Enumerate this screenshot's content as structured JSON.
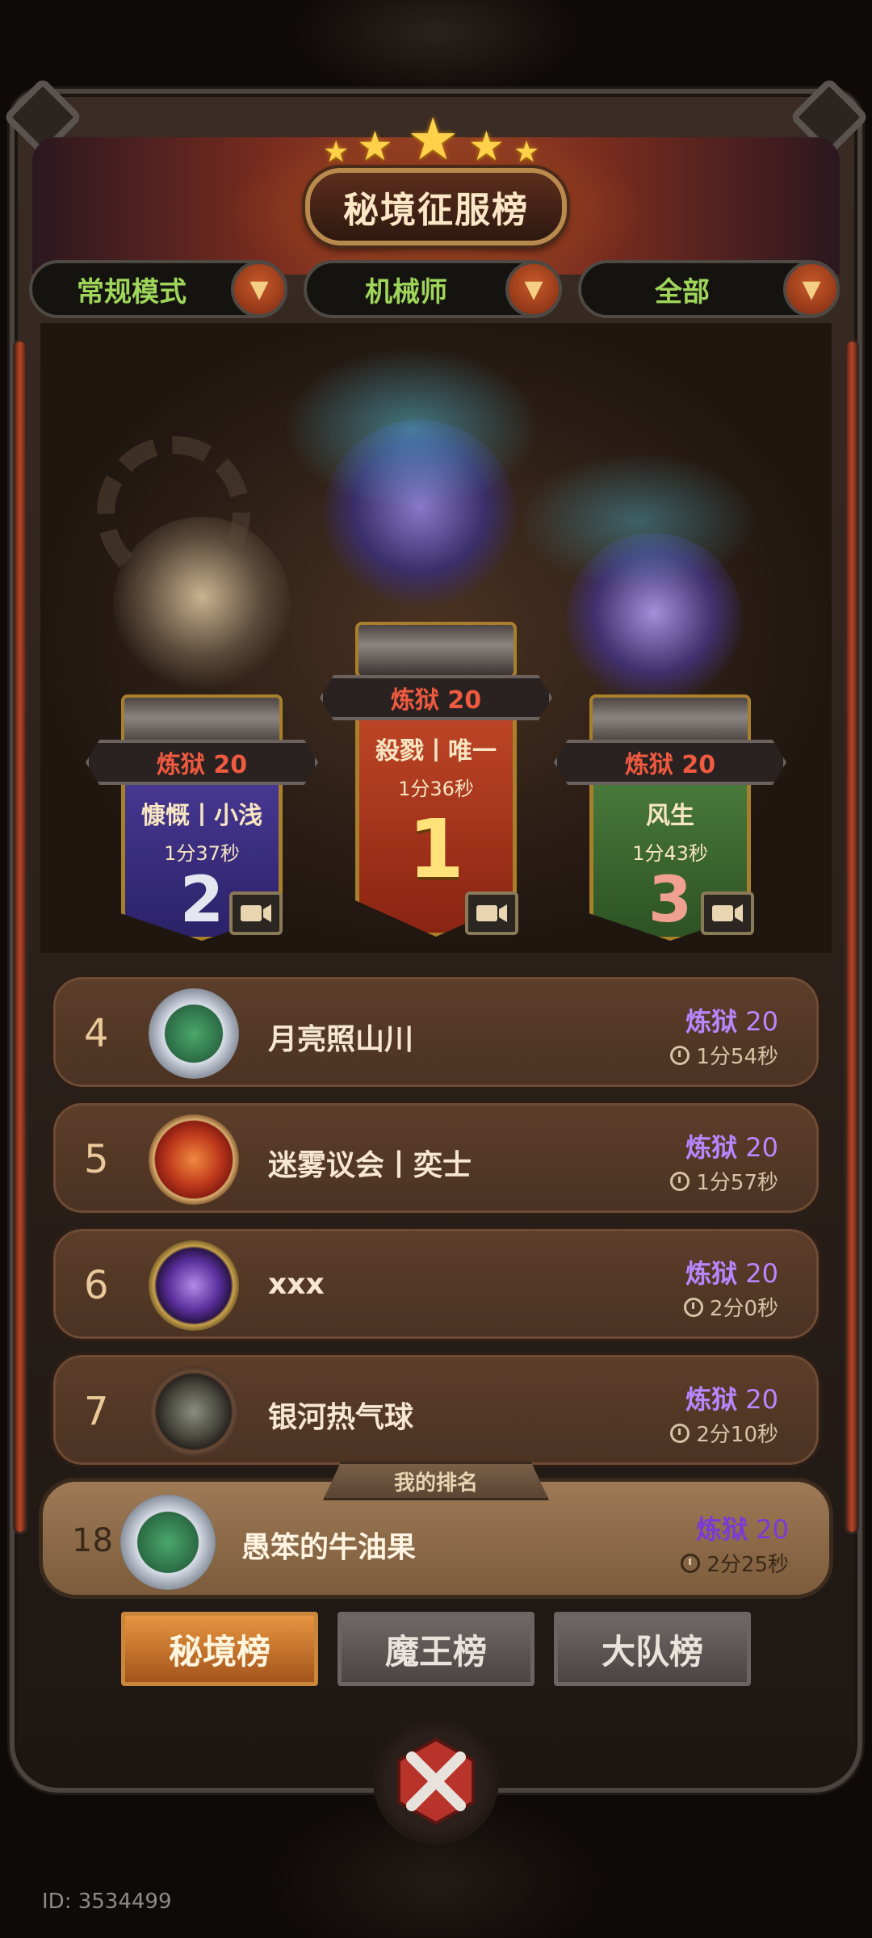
{
  "header": {
    "title": "秘境征服榜"
  },
  "filters": [
    {
      "label": "常规模式"
    },
    {
      "label": "机械师"
    },
    {
      "label": "全部"
    }
  ],
  "podium": {
    "first": {
      "rank": "1",
      "difficulty": "炼狱 20",
      "name": "殺戮丨唯一",
      "time": "1分36秒"
    },
    "second": {
      "rank": "2",
      "difficulty": "炼狱 20",
      "name": "慷慨丨小浅",
      "time": "1分37秒"
    },
    "third": {
      "rank": "3",
      "difficulty": "炼狱 20",
      "name": "风生",
      "time": "1分43秒"
    }
  },
  "rows": [
    {
      "rank": "4",
      "name": "月亮照山川",
      "difficulty_label": "炼狱",
      "difficulty_level": "20",
      "time": "1分54秒"
    },
    {
      "rank": "5",
      "name": "迷雾议会丨奕士",
      "difficulty_label": "炼狱",
      "difficulty_level": "20",
      "time": "1分57秒"
    },
    {
      "rank": "6",
      "name": "xxx",
      "difficulty_label": "炼狱",
      "difficulty_level": "20",
      "time": "2分0秒"
    },
    {
      "rank": "7",
      "name": "银河热气球",
      "difficulty_label": "炼狱",
      "difficulty_level": "20",
      "time": "2分10秒"
    }
  ],
  "my_rank": {
    "tab_label": "我的排名",
    "rank": "18",
    "name": "愚笨的牛油果",
    "difficulty_label": "炼狱",
    "difficulty_level": "20",
    "time": "2分25秒"
  },
  "tabs": [
    {
      "label": "秘境榜",
      "active": true
    },
    {
      "label": "魔王榜",
      "active": false
    },
    {
      "label": "大队榜",
      "active": false
    }
  ],
  "footer": {
    "id_text": "ID: 3534499"
  },
  "colors": {
    "filter_text": "#9fd65a",
    "difficulty_red": "#f05a40",
    "difficulty_purple": "#b887ff",
    "first_banner": "#b2391e",
    "second_banner": "#3a2f80",
    "third_banner": "#3d6b33"
  }
}
